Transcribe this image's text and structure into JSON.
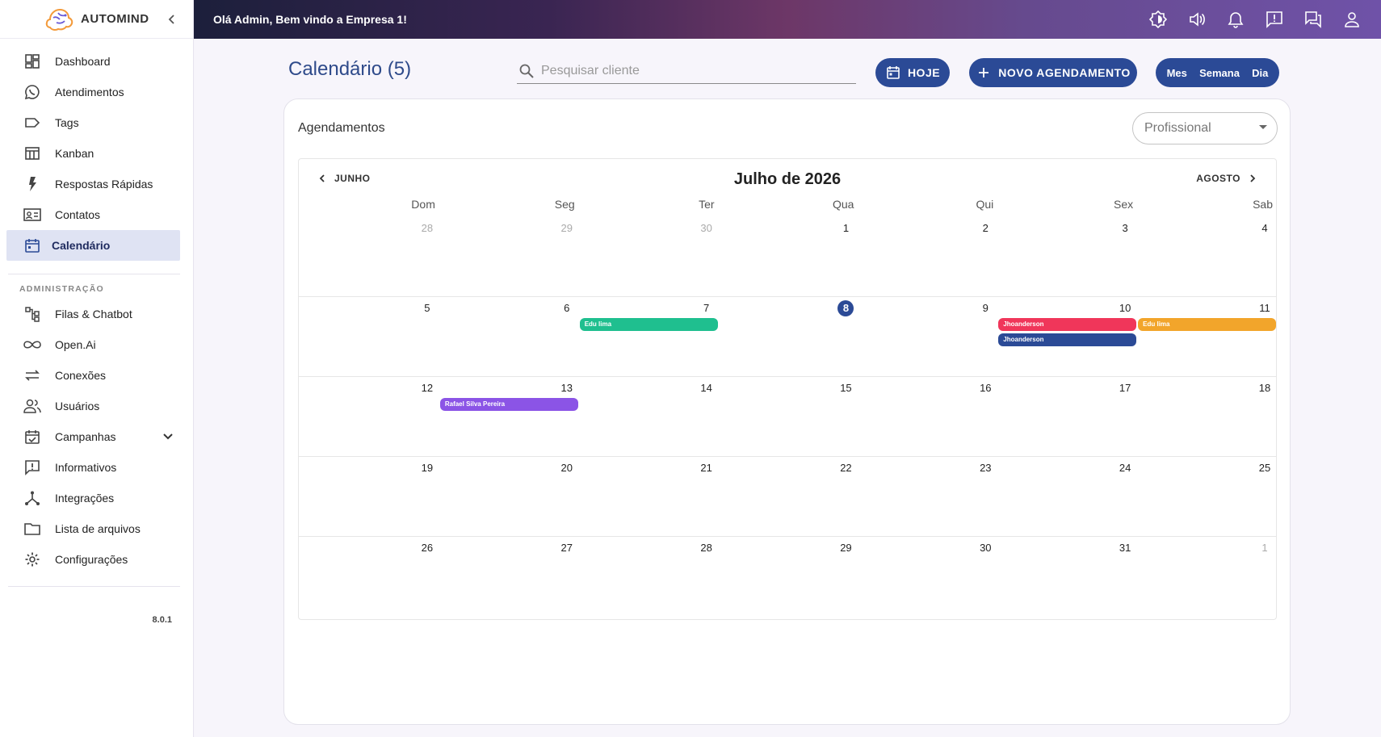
{
  "brand": {
    "name": "AUTOMIND"
  },
  "topbar": {
    "greeting": "Olá Admin, Bem vindo a Empresa 1!"
  },
  "sidebar": {
    "items": [
      {
        "label": "Dashboard",
        "icon": "dashboard-icon"
      },
      {
        "label": "Atendimentos",
        "icon": "whatsapp-icon"
      },
      {
        "label": "Tags",
        "icon": "tag-icon"
      },
      {
        "label": "Kanban",
        "icon": "kanban-icon"
      },
      {
        "label": "Respostas Rápidas",
        "icon": "bolt-icon"
      },
      {
        "label": "Contatos",
        "icon": "contact-card-icon"
      },
      {
        "label": "Calendário",
        "icon": "calendar-icon",
        "active": true
      }
    ],
    "admin_title": "ADMINISTRAÇÃO",
    "admin_items": [
      {
        "label": "Filas & Chatbot",
        "icon": "flow-icon"
      },
      {
        "label": "Open.Ai",
        "icon": "infinity-icon"
      },
      {
        "label": "Conexões",
        "icon": "sync-arrows-icon"
      },
      {
        "label": "Usuários",
        "icon": "users-icon"
      },
      {
        "label": "Campanhas",
        "icon": "event-check-icon"
      },
      {
        "label": "Informativos",
        "icon": "announcement-icon"
      },
      {
        "label": "Integrações",
        "icon": "hub-icon"
      },
      {
        "label": "Lista de arquivos",
        "icon": "folder-icon"
      },
      {
        "label": "Configurações",
        "icon": "gear-icon"
      }
    ],
    "version": "8.0.1"
  },
  "header": {
    "title": "Calendário (5)",
    "search_placeholder": "Pesquisar cliente",
    "today_label": "HOJE",
    "new_label": "NOVO AGENDAMENTO",
    "views": [
      "Mes",
      "Semana",
      "Dia"
    ]
  },
  "card": {
    "title": "Agendamentos",
    "professional_placeholder": "Profissional"
  },
  "calendar": {
    "prev_label": "JUNHO",
    "next_label": "AGOSTO",
    "month_title": "Julho de 2026",
    "weekdays": [
      "Dom",
      "Seg",
      "Ter",
      "Qua",
      "Qui",
      "Sex",
      "Sab"
    ],
    "weeks": [
      [
        {
          "d": "28",
          "other": true
        },
        {
          "d": "29",
          "other": true
        },
        {
          "d": "30",
          "other": true
        },
        {
          "d": "1"
        },
        {
          "d": "2"
        },
        {
          "d": "3"
        },
        {
          "d": "4"
        }
      ],
      [
        {
          "d": "5"
        },
        {
          "d": "6"
        },
        {
          "d": "7"
        },
        {
          "d": "8",
          "today": true
        },
        {
          "d": "9"
        },
        {
          "d": "10"
        },
        {
          "d": "11"
        }
      ],
      [
        {
          "d": "12"
        },
        {
          "d": "13"
        },
        {
          "d": "14"
        },
        {
          "d": "15"
        },
        {
          "d": "16"
        },
        {
          "d": "17"
        },
        {
          "d": "18"
        }
      ],
      [
        {
          "d": "19"
        },
        {
          "d": "20"
        },
        {
          "d": "21"
        },
        {
          "d": "22"
        },
        {
          "d": "23"
        },
        {
          "d": "24"
        },
        {
          "d": "25"
        }
      ],
      [
        {
          "d": "26"
        },
        {
          "d": "27"
        },
        {
          "d": "28"
        },
        {
          "d": "29"
        },
        {
          "d": "30"
        },
        {
          "d": "31"
        },
        {
          "d": "1",
          "other": true
        }
      ]
    ],
    "events": [
      {
        "title": "Edu lima",
        "week": 1,
        "day_start": 2,
        "day_end": 2,
        "lane": 0,
        "color": "#1fbf8f"
      },
      {
        "title": "Jhoanderson",
        "week": 1,
        "day_start": 5,
        "day_end": 5,
        "lane": 0,
        "color": "#f0365a"
      },
      {
        "title": "Edu lima",
        "week": 1,
        "day_start": 6,
        "day_end": 6,
        "lane": 0,
        "color": "#f2a52b"
      },
      {
        "title": "Jhoanderson",
        "week": 1,
        "day_start": 5,
        "day_end": 5,
        "lane": 1,
        "color": "#2b4a96"
      },
      {
        "title": "Rafael Silva Pereira",
        "week": 2,
        "day_start": 1,
        "day_end": 1,
        "lane": 0,
        "color": "#8b54e6"
      }
    ]
  },
  "colors": {
    "accent": "#2b4a96",
    "today": "#2b4a96"
  }
}
